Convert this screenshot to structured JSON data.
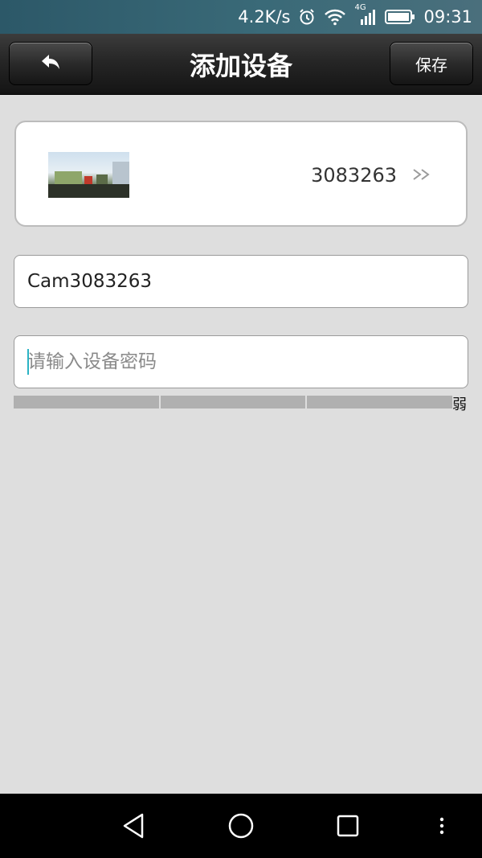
{
  "status_bar": {
    "speed": "4.2K/s",
    "network": "4G",
    "time": "09:31",
    "icons": [
      "alarm-icon",
      "wifi-icon",
      "signal-icon",
      "battery-icon"
    ]
  },
  "header": {
    "title": "添加设备",
    "save_label": "保存",
    "back_icon": "back-arrow-icon"
  },
  "device": {
    "id": "3083263",
    "thumbnail": "camera-snapshot"
  },
  "form": {
    "name_value": "Cam3083263",
    "password_placeholder": "请输入设备密码",
    "password_value": "",
    "strength_label": "弱",
    "strength_segments": 3
  },
  "nav": {
    "icons": [
      "back-triangle-icon",
      "home-circle-icon",
      "recents-square-icon",
      "menu-dots-icon"
    ]
  },
  "colors": {
    "background": "#dedede",
    "title_bar": "#262626",
    "status_bar": "#2c5868",
    "strength_bar": "#b0b0b0"
  }
}
